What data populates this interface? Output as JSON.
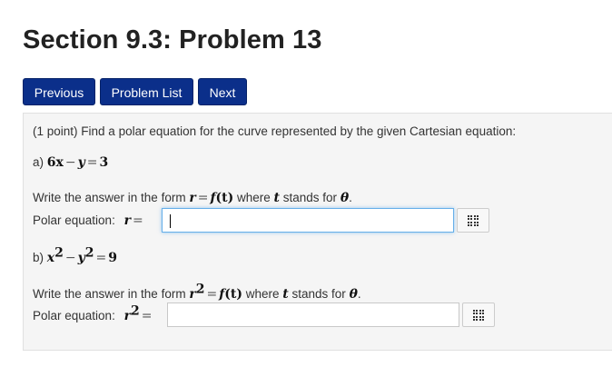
{
  "page": {
    "title": "Section 9.3: Problem 13"
  },
  "nav": {
    "previous": "Previous",
    "problem_list": "Problem List",
    "next": "Next"
  },
  "problem": {
    "points": "(1 point)",
    "intro": "Find a polar equation for the curve represented by the given Cartesian equation:",
    "part_a": {
      "label": "a)",
      "equation": {
        "t1": "6x",
        "minus": "−",
        "t2": "y",
        "eq": "=",
        "t3": "3"
      },
      "instruction": {
        "prefix": "Write the answer in the form",
        "r": "r",
        "eq": "=",
        "f": "f",
        "t_arg": "(t)",
        "where": "where",
        "t": "t",
        "stands": "stands for",
        "theta": "θ",
        "dot": "."
      },
      "answer_label": "Polar equation:",
      "answer_var": "r",
      "answer_eq": "=",
      "answer_value": ""
    },
    "part_b": {
      "label": "b)",
      "equation": {
        "x": "x",
        "exp1": "2",
        "minus": "−",
        "y": "y",
        "exp2": "2",
        "eq": "=",
        "rhs": "9"
      },
      "instruction": {
        "prefix": "Write the answer in the form",
        "r": "r",
        "exp": "2",
        "eq": "=",
        "f": "f",
        "t_arg": "(t)",
        "where": "where",
        "t": "t",
        "stands": "stands for",
        "theta": "θ",
        "dot": "."
      },
      "answer_label": "Polar equation:",
      "answer_var": "r",
      "answer_exp": "2",
      "answer_eq": "=",
      "answer_value": ""
    }
  },
  "icons": {
    "palette": "grid-icon"
  },
  "colors": {
    "nav_button_bg": "#0b2f8a",
    "panel_bg": "#f5f5f5",
    "focus_ring": "#66afe9"
  }
}
